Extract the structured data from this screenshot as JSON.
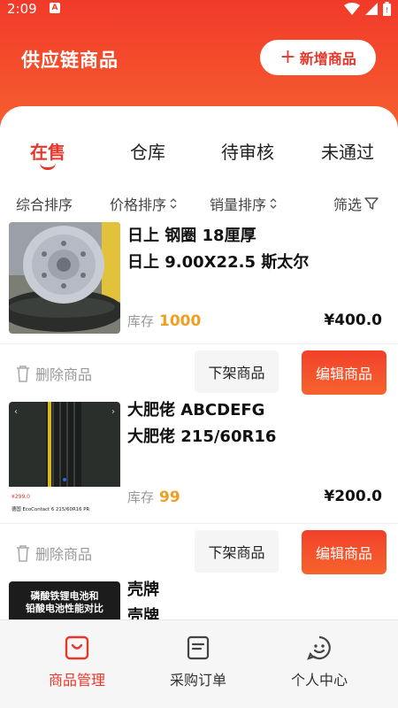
{
  "status_bar": {
    "time": "2:09",
    "notif_letter": "A"
  },
  "header": {
    "title": "供应链商品",
    "add_button": "新增商品"
  },
  "tabs": [
    {
      "label": "在售",
      "active": true
    },
    {
      "label": "仓库",
      "active": false
    },
    {
      "label": "待审核",
      "active": false
    },
    {
      "label": "未通过",
      "active": false
    }
  ],
  "sort": {
    "overall": "综合排序",
    "price": "价格排序",
    "sales": "销量排序",
    "filter": "筛选"
  },
  "products": [
    {
      "title_line1": "日上 钢圈  18厘厚",
      "title_line2": "日上   9.00X22.5 斯太尔",
      "stock_label": "库存",
      "stock": "1000",
      "price": "¥400.0",
      "delete": "删除商品",
      "off_shelf": "下架商品",
      "edit": "编辑商品"
    },
    {
      "title_line1": "大肥佬 ABCDEFG",
      "title_line2": "大肥佬   215/60R16",
      "stock_label": "库存",
      "stock": "99",
      "price": "¥200.0",
      "delete": "删除商品",
      "off_shelf": "下架商品",
      "edit": "编辑商品",
      "image_caption_price": "¥299.0",
      "image_caption": "德国 EcoContact 6 215/60R16 PR"
    },
    {
      "title_line1": "壳牌",
      "title_line2": "壳牌",
      "image_text_line1": "磷酸铁锂电池和",
      "image_text_line2": "铅酸电池性能对比"
    }
  ],
  "bottom_nav": [
    {
      "label": "商品管理",
      "icon": "bag-icon",
      "active": true
    },
    {
      "label": "采购订单",
      "icon": "order-icon",
      "active": false
    },
    {
      "label": "个人中心",
      "icon": "smile-icon",
      "active": false
    }
  ],
  "colors": {
    "accent": "#e8362a",
    "stock": "#f0a020"
  }
}
